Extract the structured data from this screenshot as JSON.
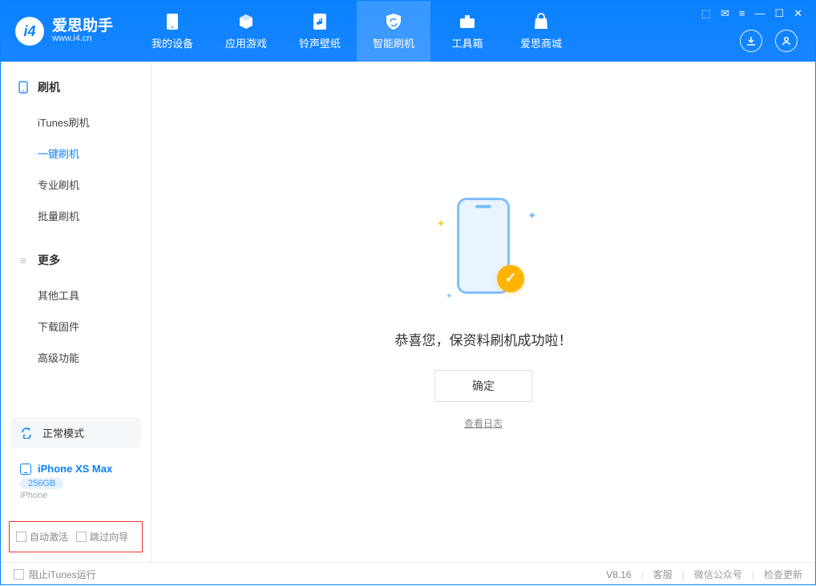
{
  "header": {
    "logo_cn": "爱思助手",
    "logo_url": "www.i4.cn",
    "nav": [
      {
        "label": "我的设备"
      },
      {
        "label": "应用游戏"
      },
      {
        "label": "铃声壁纸"
      },
      {
        "label": "智能刷机"
      },
      {
        "label": "工具箱"
      },
      {
        "label": "爱思商城"
      }
    ]
  },
  "sidebar": {
    "section1": {
      "title": "刷机",
      "items": [
        {
          "label": "iTunes刷机"
        },
        {
          "label": "一键刷机"
        },
        {
          "label": "专业刷机"
        },
        {
          "label": "批量刷机"
        }
      ]
    },
    "section2": {
      "title": "更多",
      "items": [
        {
          "label": "其他工具"
        },
        {
          "label": "下载固件"
        },
        {
          "label": "高级功能"
        }
      ]
    },
    "mode_label": "正常模式",
    "device": {
      "name": "iPhone XS Max",
      "storage": "256GB",
      "type": "iPhone"
    },
    "checks": {
      "auto_activate": "自动激活",
      "skip_guide": "跳过向导"
    }
  },
  "main": {
    "success_text": "恭喜您，保资料刷机成功啦！",
    "ok_button": "确定",
    "view_log": "查看日志"
  },
  "footer": {
    "block_itunes": "阻止iTunes运行",
    "version": "V8.16",
    "links": {
      "support": "客服",
      "wechat": "微信公众号",
      "check_update": "检查更新"
    }
  }
}
